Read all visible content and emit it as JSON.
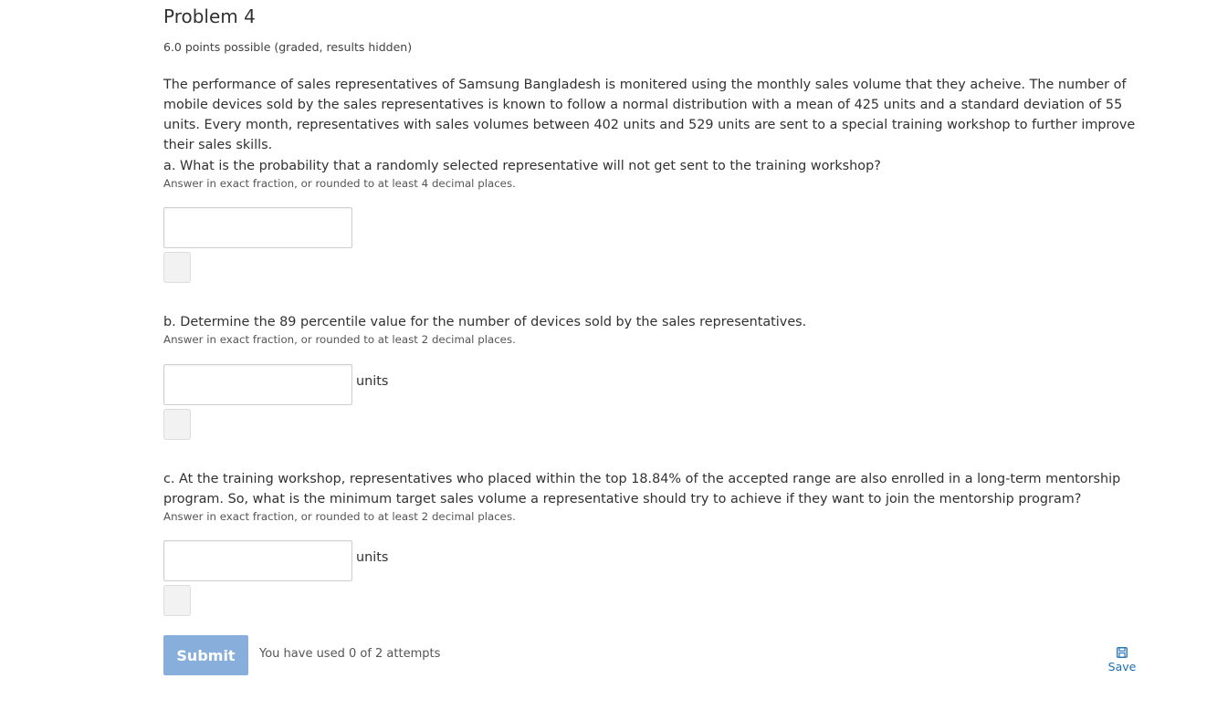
{
  "problem": {
    "title": "Problem 4",
    "points": "6.0 points possible (graded, results hidden)",
    "intro": "The performance of sales representatives of Samsung Bangladesh is monitered using the monthly sales volume that they acheive. The number of mobile devices sold by the sales representatives is known to follow a normal distribution with a mean of 425 units and a standard deviation of 55 units. Every month, representatives with sales volumes between 402 units and 529 units are sent to a special training workshop to further improve their sales skills."
  },
  "parts": [
    {
      "question": "a. What is the probability that a randomly selected representative will not get sent to the training workshop?",
      "hint": "Answer in exact fraction, or rounded to at least 4 decimal places.",
      "value": "",
      "unit": ""
    },
    {
      "question": "b. Determine the 89 percentile value for the number of devices sold by the sales representatives.",
      "hint": "Answer in exact fraction, or rounded to at least 2 decimal places.",
      "value": "",
      "unit": "units"
    },
    {
      "question": "c. At the training workshop, representatives who placed within the top 18.84% of the accepted range are also enrolled in a long-term mentorship program. So, what is the minimum target sales volume a representative should try to achieve if they want to join the mentorship program?",
      "hint": "Answer in exact fraction, or rounded to at least 2 decimal places.",
      "value": "",
      "unit": "units"
    }
  ],
  "actions": {
    "submit_label": "Submit",
    "attempts_text": "You have used 0 of 2 attempts",
    "save_label": "Save",
    "save_icon": "floppy-disk-icon",
    "submit_color": "#88aedb",
    "link_color": "#1f6eb0"
  }
}
